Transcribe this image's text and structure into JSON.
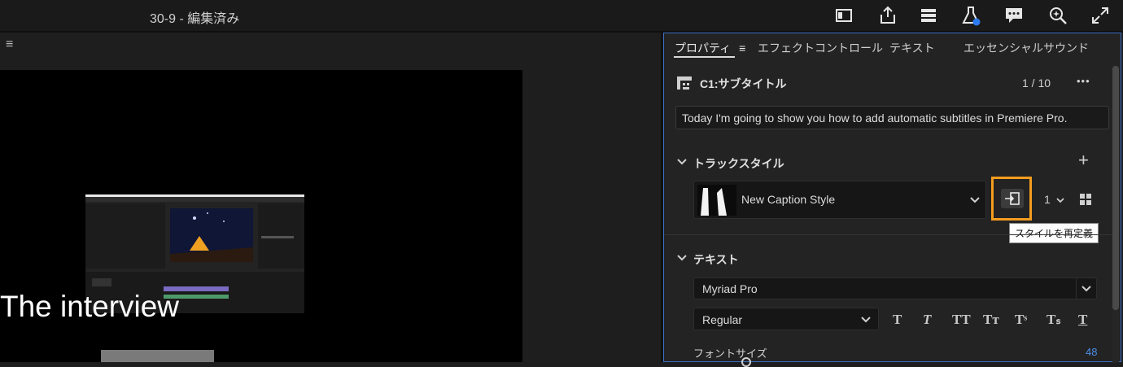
{
  "header": {
    "title": "30-9 - 編集済み"
  },
  "toolbar_icons": [
    "panel-icon",
    "share-icon",
    "layers-icon",
    "beaker-icon",
    "comment-icon",
    "search-sparkle-icon",
    "expand-icon"
  ],
  "program_monitor": {
    "menu_glyph": "≡",
    "overlay_text": "The interview"
  },
  "panel": {
    "tabs": [
      {
        "label": "プロパティ",
        "menu_glyph": "≡"
      },
      {
        "label": "エフェクトコントロール"
      },
      {
        "label": "テキスト"
      },
      {
        "label": "エッセンシャルサウンド"
      }
    ],
    "caption": {
      "title": "C1:サブタイトル",
      "counter": "1 / 10",
      "more": "•••",
      "text": "Today I'm going to show you how to add automatic subtitles in Premiere Pro."
    },
    "track_style": {
      "title": "トラックスタイル",
      "add": "+",
      "style_name": "New Caption Style",
      "count": "1",
      "tooltip": "スタイルを再定義"
    },
    "text_section": {
      "title": "テキスト",
      "font_family": "Myriad Pro",
      "font_style": "Regular",
      "style_glyphs": [
        "T",
        "T",
        "TT",
        "Tт",
        "Tˢ",
        "Tₛ",
        "T"
      ],
      "font_size_label": "フォントサイズ",
      "font_size_value": "48"
    }
  },
  "colors": {
    "accent": "#3d6fc4",
    "highlight": "#f39c1e",
    "value_blue": "#4c8fe8"
  }
}
